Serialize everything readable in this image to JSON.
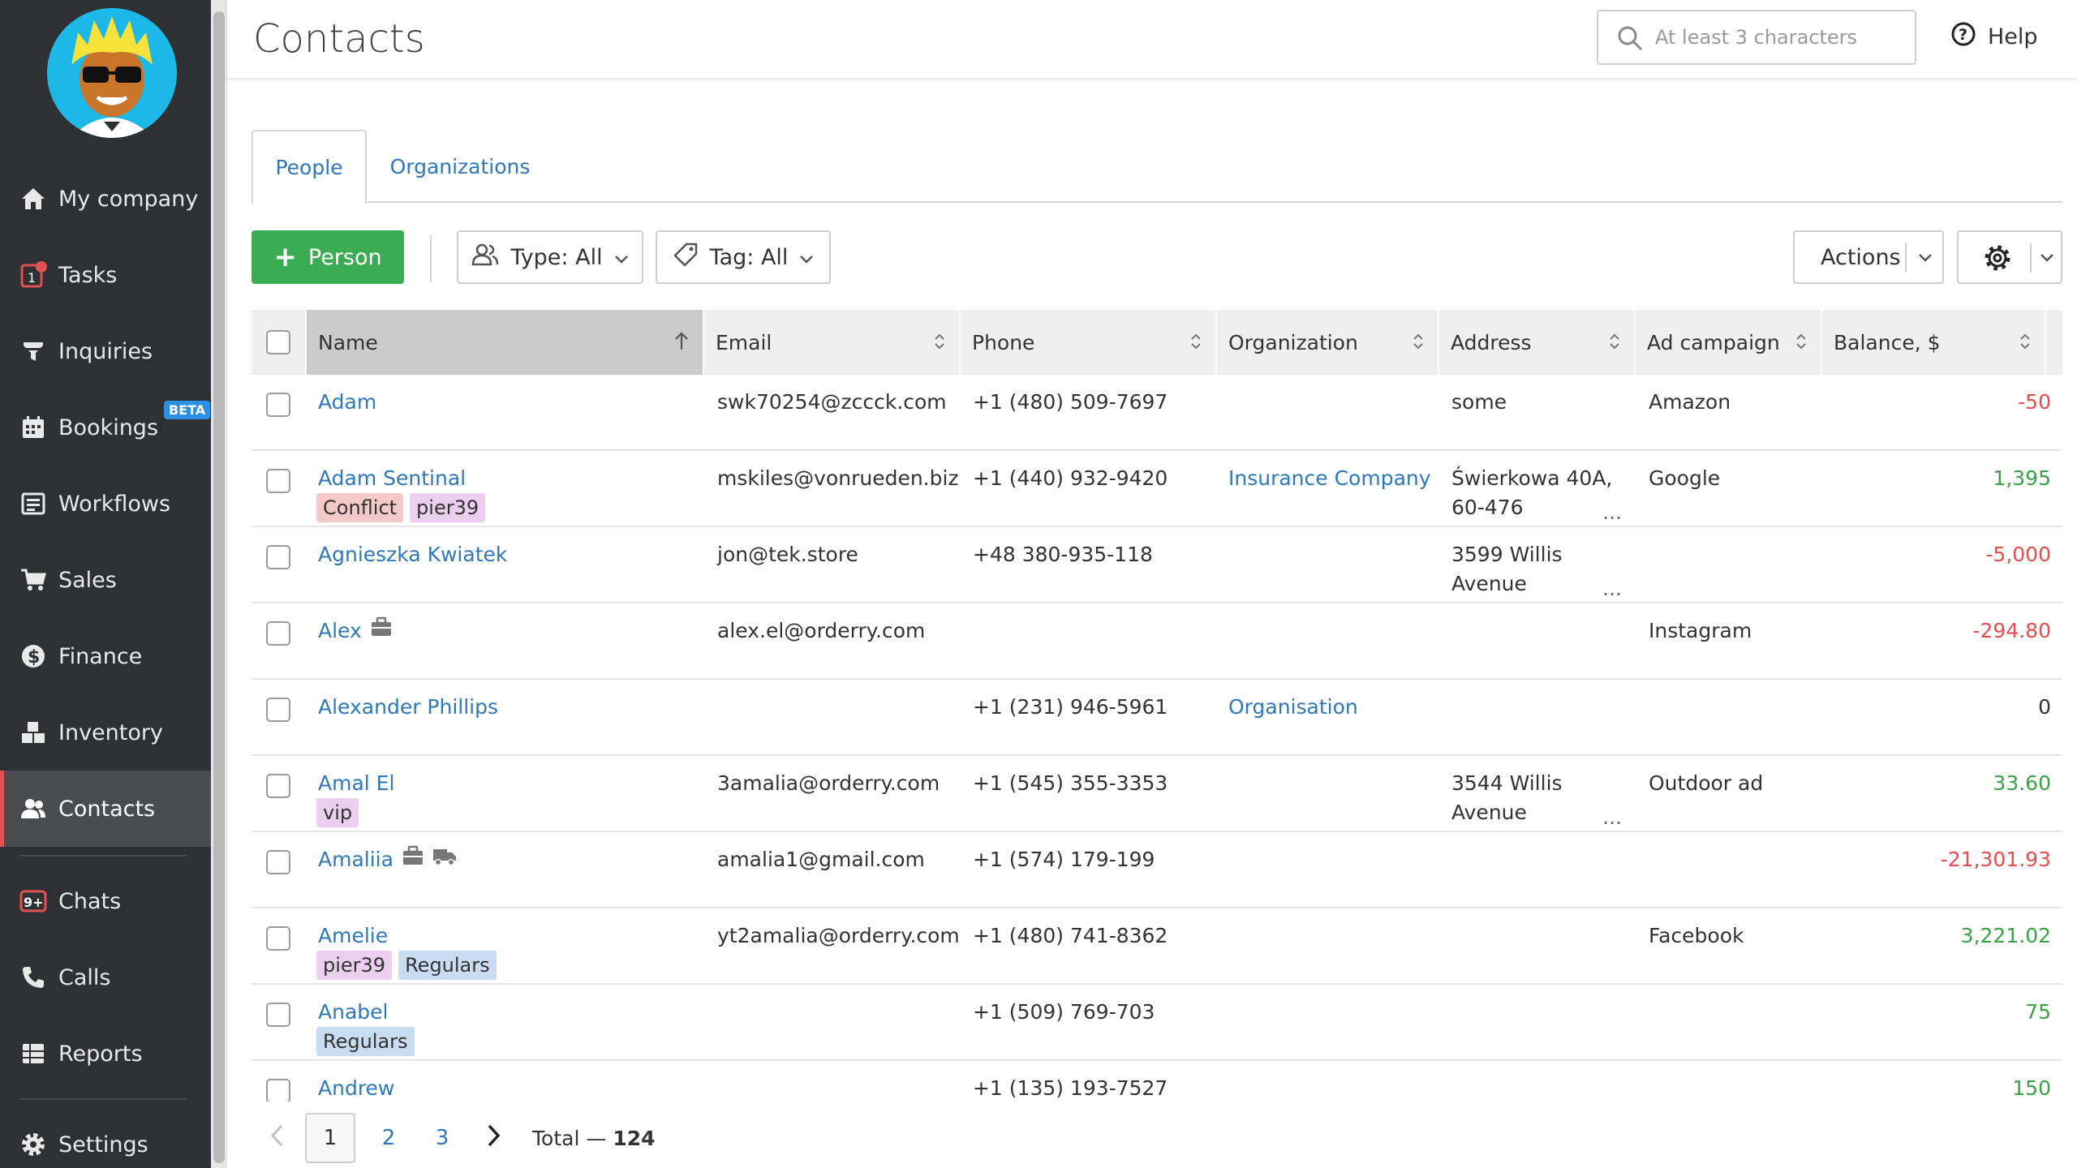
{
  "sidebar": {
    "items": [
      {
        "label": "My company",
        "icon": "home-icon"
      },
      {
        "label": "Tasks",
        "icon": "tasks-icon",
        "badge": "1"
      },
      {
        "label": "Inquiries",
        "icon": "funnel-icon"
      },
      {
        "label": "Bookings",
        "icon": "calendar-icon",
        "beta": "BETA"
      },
      {
        "label": "Workflows",
        "icon": "workflow-icon"
      },
      {
        "label": "Sales",
        "icon": "cart-icon"
      },
      {
        "label": "Finance",
        "icon": "dollar-icon"
      },
      {
        "label": "Inventory",
        "icon": "boxes-icon"
      },
      {
        "label": "Contacts",
        "icon": "people-icon",
        "active": true
      },
      {
        "label": "Chats",
        "icon": "chat-icon",
        "badge": "9+"
      },
      {
        "label": "Calls",
        "icon": "phone-icon"
      },
      {
        "label": "Reports",
        "icon": "reports-icon"
      },
      {
        "label": "Settings",
        "icon": "gear-icon"
      }
    ]
  },
  "header": {
    "title": "Contacts",
    "search_placeholder": "At least 3 characters",
    "help": "Help"
  },
  "tabs": [
    {
      "label": "People",
      "active": true
    },
    {
      "label": "Organizations",
      "active": false
    }
  ],
  "toolbar": {
    "add_person": "Person",
    "type_filter": "Type: All",
    "tag_filter": "Tag: All",
    "actions": "Actions"
  },
  "table": {
    "columns": [
      "Name",
      "Email",
      "Phone",
      "Organization",
      "Address",
      "Ad campaign",
      "Balance, $"
    ],
    "rows": [
      {
        "name": "Adam",
        "email": "swk70254@zccck.com",
        "phone": "+1 (480) 509-7697",
        "org": "",
        "addr": "some",
        "campaign": "Amazon",
        "balance": "-50",
        "tags": []
      },
      {
        "name": "Adam Sentinal",
        "email": "mskiles@vonrueden.biz",
        "phone": "+1 (440) 932-9420",
        "org": "Insurance Company",
        "addr": "Świerkowa 40A, 60-476",
        "campaign": "Google",
        "balance": "1,395",
        "tags": [
          "Conflict",
          "pier39"
        ]
      },
      {
        "name": "Agnieszka Kwiatek",
        "email": "jon@tek.store",
        "phone": "+48 380-935-118",
        "org": "",
        "addr": "3599 Willis Avenue",
        "campaign": "",
        "balance": "-5,000",
        "tags": []
      },
      {
        "name": "Alex",
        "email": "alex.el@orderry.com",
        "phone": "",
        "org": "",
        "addr": "",
        "campaign": "Instagram",
        "balance": "-294.80",
        "tags": []
      },
      {
        "name": "Alexander Phillips",
        "email": "",
        "phone": "+1 (231) 946-5961",
        "org": "Organisation",
        "addr": "",
        "campaign": "",
        "balance": "0",
        "tags": []
      },
      {
        "name": "Amal El",
        "email": "3amalia@orderry.com",
        "phone": "+1 (545) 355-3353",
        "org": "",
        "addr": "3544 Willis Avenue",
        "campaign": "Outdoor ad",
        "balance": "33.60",
        "tags": [
          "vip"
        ]
      },
      {
        "name": "Amaliia",
        "email": "amalia1@gmail.com",
        "phone": "+1 (574) 179-199",
        "org": "",
        "addr": "",
        "campaign": "",
        "balance": "-21,301.93",
        "tags": []
      },
      {
        "name": "Amelie",
        "email": "yt2amalia@orderry.com",
        "phone": "+1 (480) 741-8362",
        "org": "",
        "addr": "",
        "campaign": "Facebook",
        "balance": "3,221.02",
        "tags": [
          "pier39",
          "Regulars"
        ]
      },
      {
        "name": "Anabel",
        "email": "",
        "phone": "+1 (509) 769-703",
        "org": "",
        "addr": "",
        "campaign": "",
        "balance": "75",
        "tags": [
          "Regulars"
        ]
      },
      {
        "name": "Andrew",
        "email": "",
        "phone": "+1 (135) 193-7527",
        "org": "",
        "addr": "",
        "campaign": "",
        "balance": "150",
        "tags": []
      }
    ],
    "ellipsis": "..."
  },
  "pagination": {
    "pages": [
      "1",
      "2",
      "3"
    ],
    "current": "1",
    "total_label": "Total —",
    "total": "124"
  },
  "colors": {
    "sidebar_bg": "#2f3034",
    "accent_link": "#2f78b9",
    "primary_button": "#3cac54",
    "negative": "#e84d4d",
    "positive": "#3aa348"
  }
}
